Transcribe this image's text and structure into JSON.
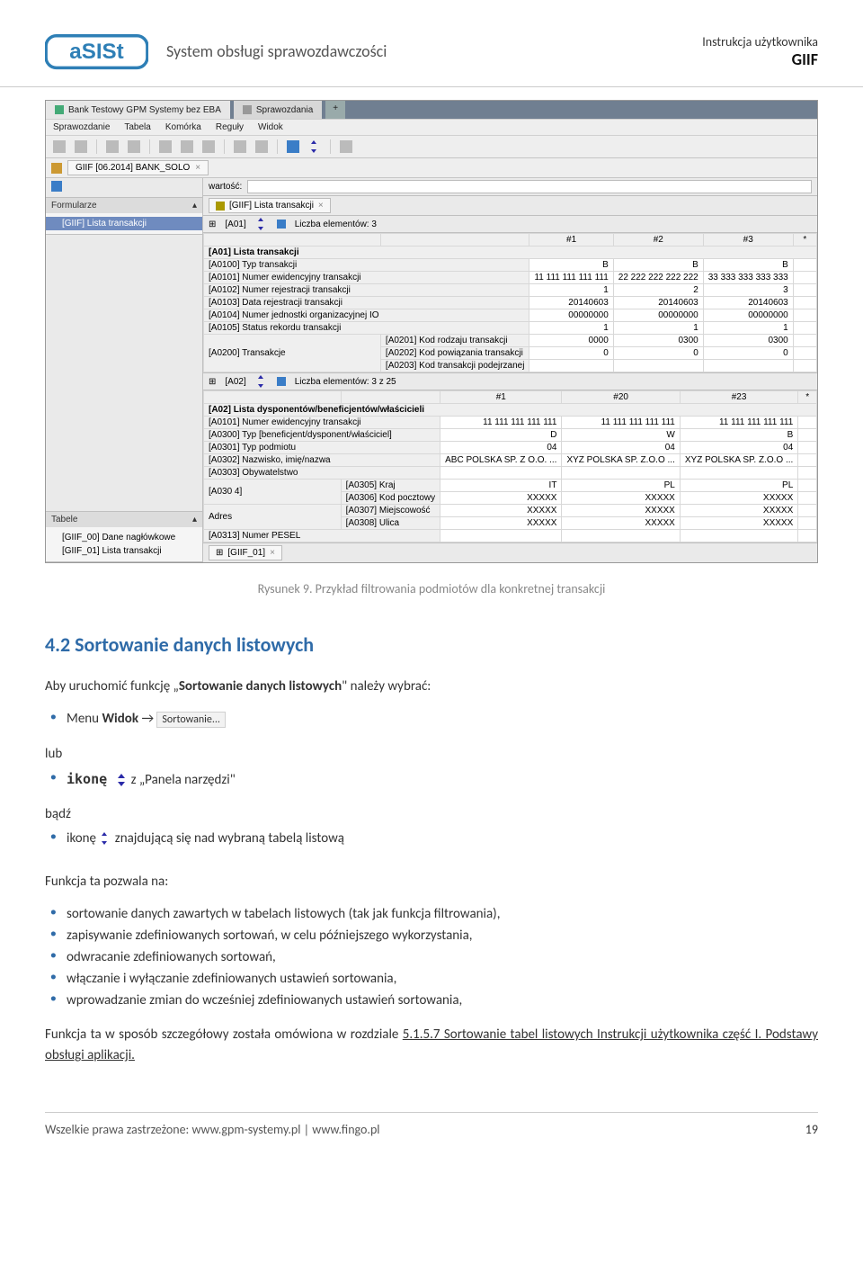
{
  "header": {
    "system_title": "System obsługi sprawozdawczości",
    "manual_label": "Instrukcja użytkownika",
    "giif": "GIIF"
  },
  "shot": {
    "top_tab1": "Bank Testowy GPM Systemy bez EBA",
    "top_tab2": "Sprawozdania",
    "menu": [
      "Sprawozdanie",
      "Tabela",
      "Komórka",
      "Reguły",
      "Widok"
    ],
    "doc_tab": "GIIF [06.2014] BANK_SOLO",
    "side_form_head": "Formularze",
    "side_form_item": "[GIIF] Lista transakcji",
    "side_tab_head": "Tabele",
    "side_tab_item1": "[GIIF_00] Dane nagłówkowe",
    "side_tab_item2": "[GIIF_01] Lista transakcji",
    "main": {
      "wartosc_label": "wartość:",
      "inner_tab": "[GIIF] Lista transakcji",
      "a01_count_label": "[A01]",
      "a01_count_text": "Liczba elementów: 3",
      "a01_headers": [
        "#1",
        "#2",
        "#3",
        "*"
      ],
      "a01_section": "[A01] Lista transakcji",
      "a01_rows": [
        {
          "label": "[A0100] Typ transakcji",
          "v": [
            "B",
            "B",
            "B",
            ""
          ]
        },
        {
          "label": "[A0101] Numer ewidencyjny transakcji",
          "v": [
            "11 111 111 111 111",
            "22 222 222 222 222",
            "33 333 333 333 333",
            ""
          ]
        },
        {
          "label": "[A0102] Numer rejestracji transakcji",
          "v": [
            "1",
            "2",
            "3",
            ""
          ]
        },
        {
          "label": "[A0103] Data rejestracji transakcji",
          "v": [
            "20140603",
            "20140603",
            "20140603",
            ""
          ]
        },
        {
          "label": "[A0104] Numer jednostki organizacyjnej IO",
          "v": [
            "00000000",
            "00000000",
            "00000000",
            ""
          ]
        },
        {
          "label": "[A0105] Status rekordu transakcji",
          "v": [
            "1",
            "1",
            "1",
            ""
          ]
        }
      ],
      "a0200_label": "[A0200] Transakcje",
      "a0200_rows": [
        {
          "label": "[A0201] Kod rodzaju transakcji",
          "v": [
            "0000",
            "0300",
            "0300",
            ""
          ]
        },
        {
          "label": "[A0202] Kod powiązania transakcji",
          "v": [
            "0",
            "0",
            "0",
            ""
          ]
        },
        {
          "label": "[A0203] Kod transakcji podejrzanej",
          "v": [
            "",
            "",
            "",
            ""
          ]
        }
      ],
      "a02_count_label": "[A02]",
      "a02_count_text": "Liczba elementów: 3 z 25",
      "a02_headers": [
        "#1",
        "#20",
        "#23",
        "*"
      ],
      "a02_section": "[A02] Lista dysponentów/beneficjentów/właścicieli",
      "a02_rows": [
        {
          "label": "[A0101] Numer ewidencyjny transakcji",
          "v": [
            "11 111 111 111 111",
            "11 111 111 111 111",
            "11 111 111 111 111",
            ""
          ]
        },
        {
          "label": "[A0300] Typ [beneficjent/dysponent/właściciel]",
          "v": [
            "D",
            "W",
            "B",
            ""
          ]
        },
        {
          "label": "[A0301] Typ podmiotu",
          "v": [
            "04",
            "04",
            "04",
            ""
          ]
        },
        {
          "label": "[A0302] Nazwisko, imię/nazwa",
          "v": [
            "ABC POLSKA SP. Z O.O.   ...",
            "XYZ POLSKA SP. Z.O.O  ...",
            "XYZ POLSKA SP. Z.O.O  ...",
            ""
          ]
        },
        {
          "label": "[A0303] Obywatelstwo",
          "v": [
            "",
            "",
            "",
            ""
          ]
        }
      ],
      "a0304_label": "[A030\n4]",
      "a0304_rows": [
        {
          "label": "[A0305] Kraj",
          "v": [
            "IT",
            "PL",
            "PL",
            ""
          ]
        },
        {
          "label": "[A0306] Kod pocztowy",
          "v": [
            "XXXXX",
            "XXXXX",
            "XXXXX",
            ""
          ]
        }
      ],
      "adres_label": "Adres",
      "adres_rows": [
        {
          "label": "[A0307] Miejscowość",
          "v": [
            "XXXXX",
            "XXXXX",
            "XXXXX",
            ""
          ]
        },
        {
          "label": "[A0308] Ulica",
          "v": [
            "XXXXX",
            "XXXXX",
            "XXXXX",
            ""
          ]
        }
      ],
      "a0313_label": "[A0313] Numer PESEL",
      "foot_tab": "[GIIF_01]"
    }
  },
  "caption": "Rysunek 9. Przykład filtrowania podmiotów dla konkretnej transakcji",
  "sec_head": "4.2  Sortowanie danych listowych",
  "para1_pre": "Aby uruchomić funkcję „",
  "para1_b": "Sortowanie danych listowych",
  "para1_post": "\" należy wybrać:",
  "b1_pre": "Menu  ",
  "b1_b": "Widok",
  "b1_arrow": " → ",
  "sortowanie_label": "Sortowanie...",
  "lub": "lub",
  "b2_pre": "ikonę ",
  "b2_post": "   z  „Panela narzędzi\"",
  "badz": "bądź",
  "b3_pre": "ikonę ",
  "b3_post": " znajdującą się nad wybraną tabelą listową",
  "para2": "Funkcja ta pozwala na:",
  "features": [
    "sortowanie danych zawartych w tabelach listowych (tak jak funkcja filtrowania),",
    "zapisywanie zdefiniowanych sortowań, w celu późniejszego wykorzystania,",
    "odwracanie zdefiniowanych sortowań,",
    "włączanie i wyłączanie zdefiniowanych ustawień sortowania,",
    "wprowadzanie zmian do wcześniej zdefiniowanych ustawień sortowania,"
  ],
  "para3_pre": "Funkcja ta w sposób szczegółowy została omówiona w rozdziale ",
  "para3_link": "5.1.5.7 Sortowanie tabel listowych Instrukcji użytkownika część I. Podstawy obsługi aplikacji.",
  "footer": {
    "left_pre": "Wszelkie prawa zastrzeżone: ",
    "u1": "www.gpm-systemy.pl",
    "sep": "  |  ",
    "u2": "www.fingo.pl",
    "page": "19"
  }
}
